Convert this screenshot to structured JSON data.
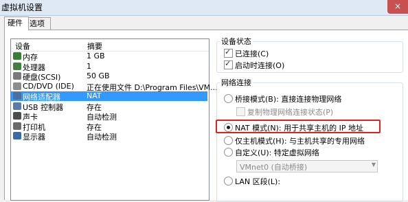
{
  "window": {
    "title": "虚拟机设置",
    "close_icon": "×"
  },
  "tabs": [
    {
      "label": "硬件"
    },
    {
      "label": "选项"
    }
  ],
  "device_list": {
    "headers": {
      "device": "设备",
      "summary": "摘要"
    },
    "rows": [
      {
        "name": "内存",
        "summary": "1 GB",
        "icon": "memory-icon",
        "icon_color": "#3a7d3a"
      },
      {
        "name": "处理器",
        "summary": "1",
        "icon": "processor-icon",
        "icon_color": "#3f7f3f"
      },
      {
        "name": "硬盘(SCSI)",
        "summary": "50 GB",
        "icon": "hard-disk-icon",
        "icon_color": "#7a7a7a"
      },
      {
        "name": "CD/DVD (IDE)",
        "summary": "正在使用文件 D:\\Program Files\\VM...",
        "icon": "cd-dvd-icon",
        "icon_color": "#8c8c8c"
      },
      {
        "name": "网络适配器",
        "summary": "NAT",
        "icon": "network-adapter-icon",
        "icon_color": "#4a6fa5"
      },
      {
        "name": "USB 控制器",
        "summary": "存在",
        "icon": "usb-icon",
        "icon_color": "#5c7aa8"
      },
      {
        "name": "声卡",
        "summary": "自动检测",
        "icon": "sound-card-icon",
        "icon_color": "#4d4d4d"
      },
      {
        "name": "打印机",
        "summary": "存在",
        "icon": "printer-icon",
        "icon_color": "#6a6a6a"
      },
      {
        "name": "显示器",
        "summary": "自动检测",
        "icon": "display-icon",
        "icon_color": "#3b6aa0"
      }
    ],
    "selected_index": 4
  },
  "device_status": {
    "legend": "设备状态",
    "connected": {
      "label": "已连接(C)",
      "checked": true
    },
    "connect_at_power_on": {
      "label": "启动时连接(O)",
      "checked": true
    }
  },
  "network_connection": {
    "legend": "网络连接",
    "bridged": {
      "label": "桥接模式(B): 直接连接物理网络",
      "selected": false
    },
    "replicate_state": {
      "label": "复制物理网络连接状态(P)",
      "checked": false
    },
    "nat": {
      "label": "NAT 模式(N): 用于共享主机的 IP 地址",
      "selected": true
    },
    "host_only": {
      "label": "仅主机模式(H): 与主机共享的专用网络",
      "selected": false
    },
    "custom": {
      "label": "自定义(U): 特定虚拟网络",
      "selected": false
    },
    "custom_select": {
      "value": "VMnet0 (自动桥接)"
    },
    "lan_segment": {
      "label": "LAN 区段(L):",
      "selected": false
    }
  },
  "colors": {
    "selection": "#3399ff",
    "highlight_box": "#e02020"
  }
}
